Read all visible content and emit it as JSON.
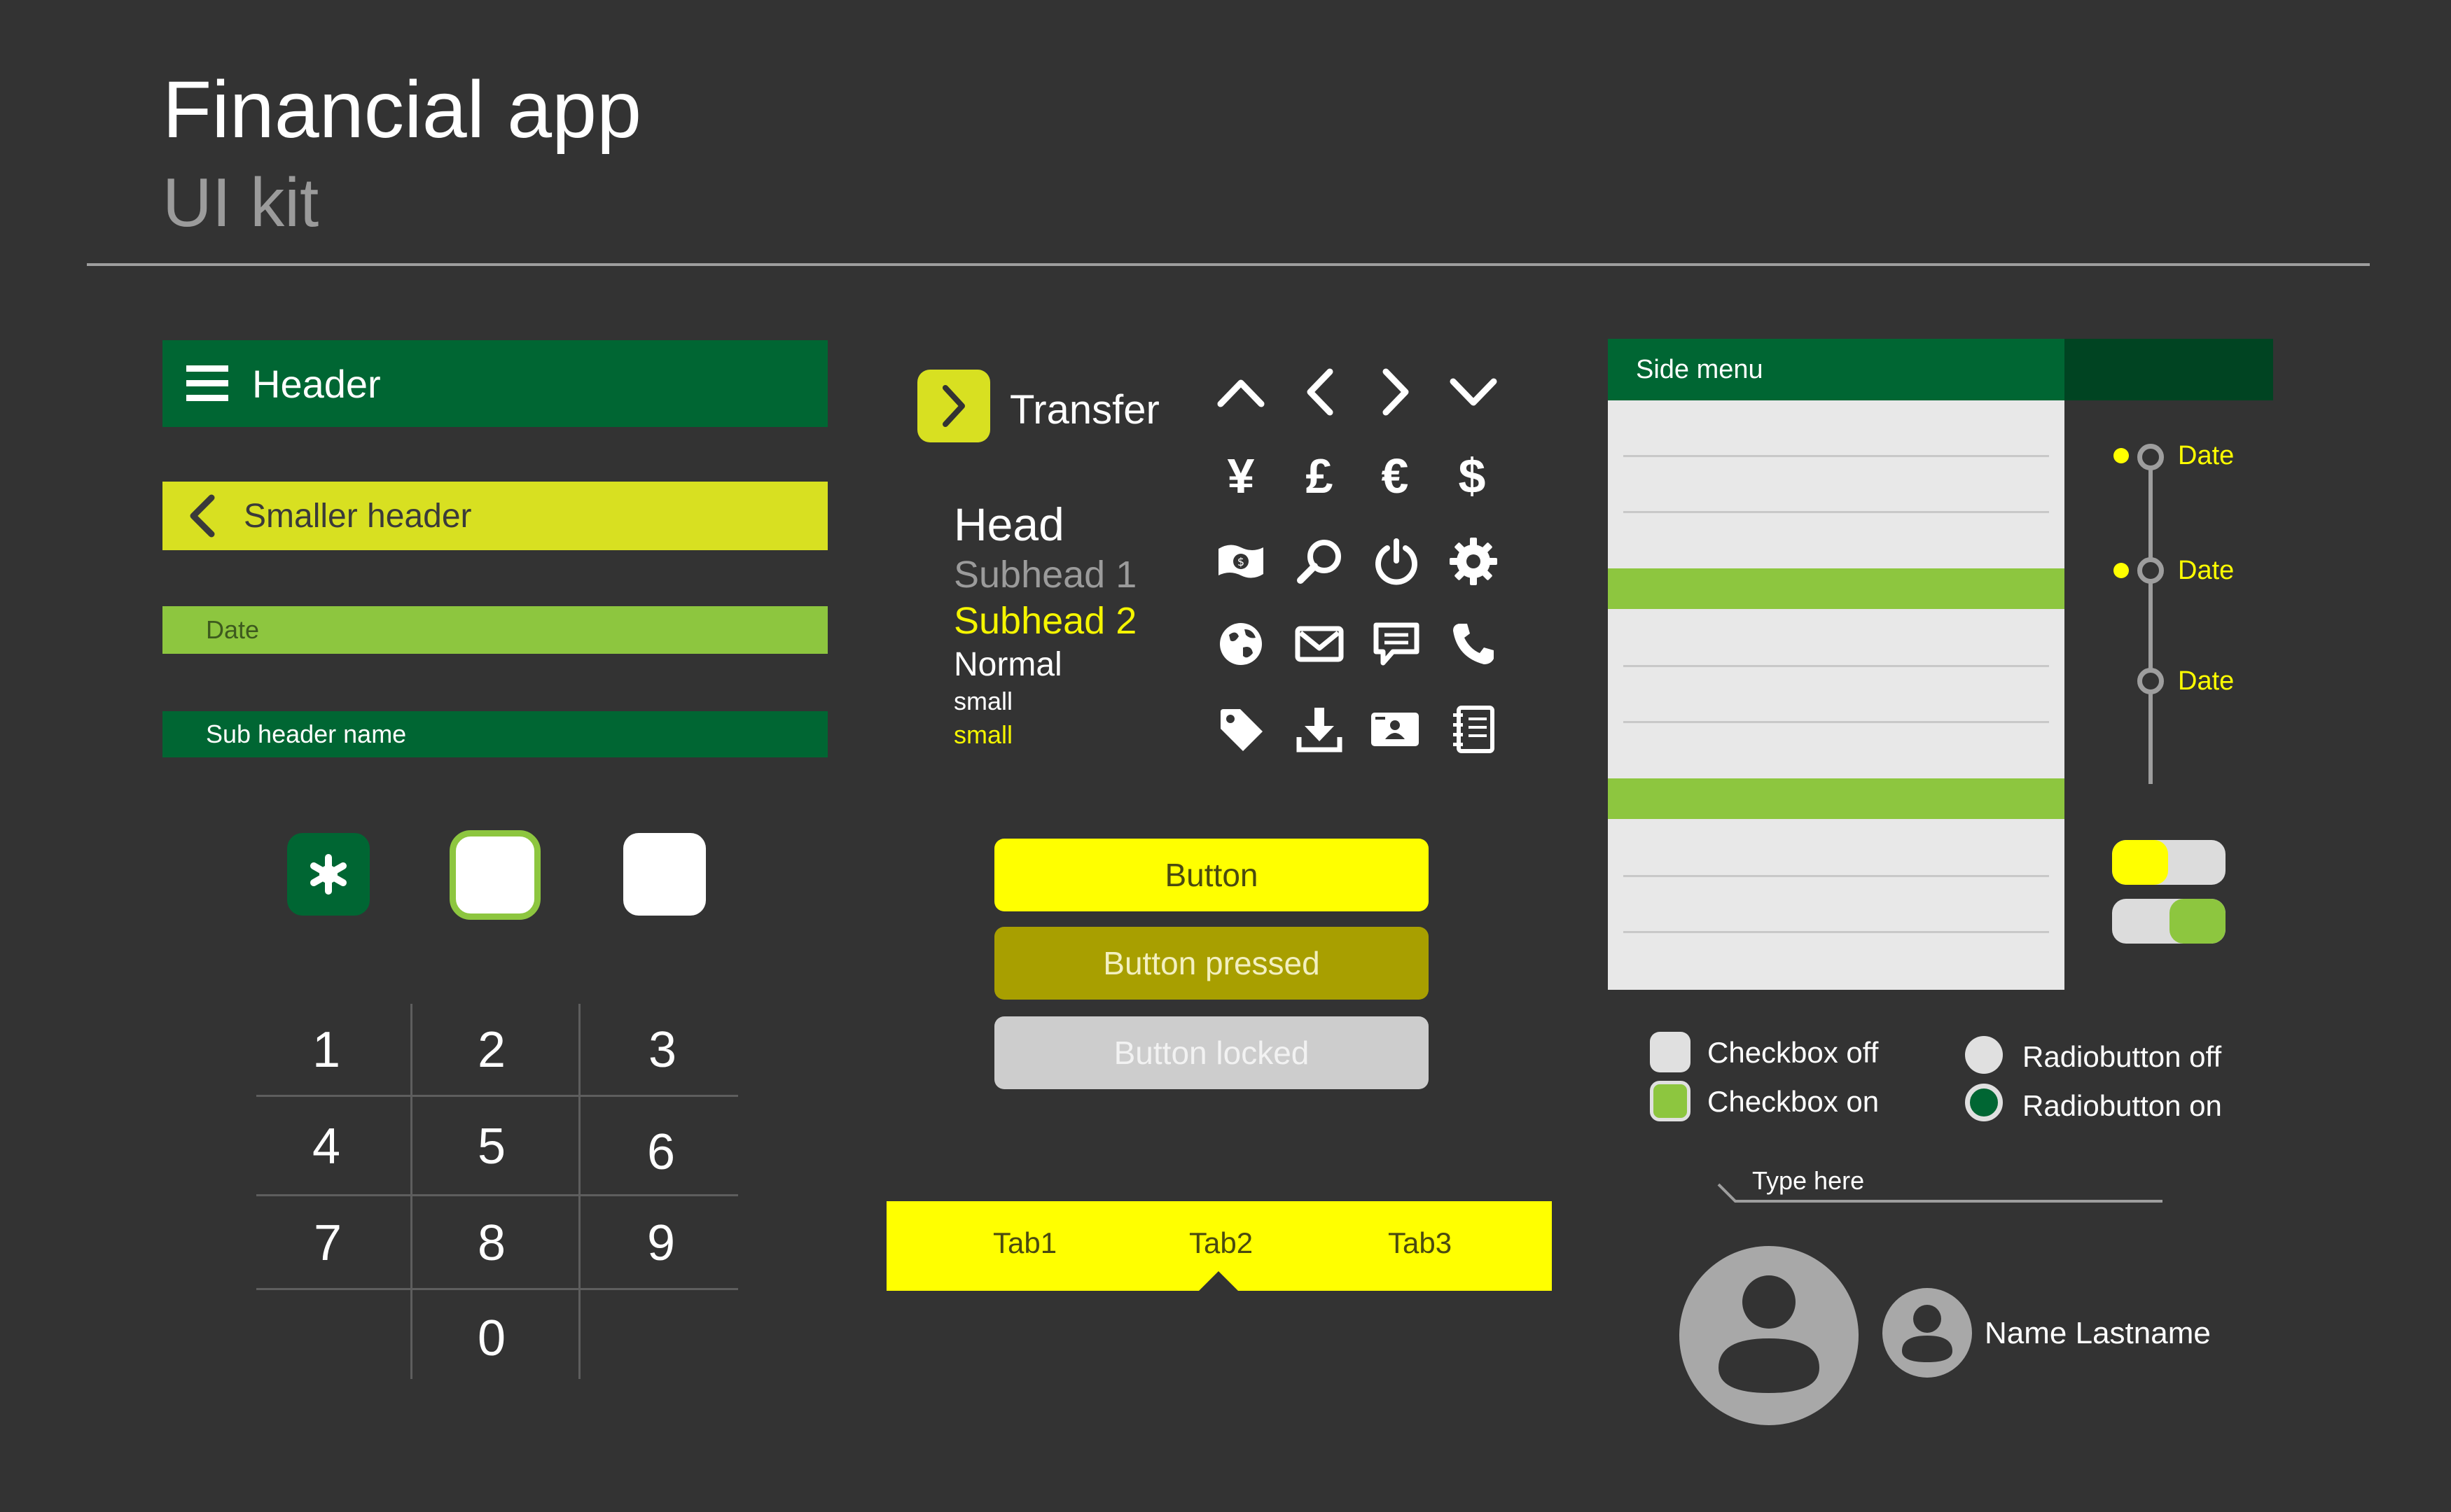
{
  "title": "Financial app",
  "subtitle": "UI kit",
  "headers": {
    "header": "Header",
    "smaller_header": "Smaller header",
    "date": "Date",
    "sub_header_name": "Sub header name"
  },
  "keypad": [
    "1",
    "2",
    "3",
    "4",
    "5",
    "6",
    "7",
    "8",
    "9",
    "0"
  ],
  "transfer": {
    "label": "Transfer"
  },
  "typography": {
    "head": "Head",
    "subhead1": "Subhead 1",
    "subhead2": "Subhead 2",
    "normal": "Normal",
    "small": "small",
    "small_accent": "small"
  },
  "currency": {
    "yen": "¥",
    "pound": "£",
    "euro": "€",
    "dollar": "$"
  },
  "icons": [
    "chevron-up-icon",
    "chevron-left-icon",
    "chevron-right-icon",
    "chevron-down-icon",
    "yen-icon",
    "pound-icon",
    "euro-icon",
    "dollar-icon",
    "money-icon",
    "search-icon",
    "power-icon",
    "gear-icon",
    "globe-icon",
    "mail-icon",
    "chat-icon",
    "phone-icon",
    "tag-icon",
    "download-icon",
    "id-card-icon",
    "notebook-icon"
  ],
  "buttons": {
    "normal": "Button",
    "pressed": "Button pressed",
    "locked": "Button locked"
  },
  "tabs": [
    "Tab1",
    "Tab2",
    "Tab3"
  ],
  "tabs_selected": 1,
  "side_menu": {
    "title": "Side menu"
  },
  "timeline": [
    "Date",
    "Date",
    "Date"
  ],
  "toggles": [
    {
      "state": "off"
    },
    {
      "state": "on"
    }
  ],
  "checkboxes": {
    "off": "Checkbox off",
    "on": "Checkbox on"
  },
  "radios": {
    "off": "Radiobutton off",
    "on": "Radiobutton on"
  },
  "input": {
    "placeholder": "Type here"
  },
  "profile": {
    "name": "Name Lastname"
  },
  "colors": {
    "background": "#333333",
    "dark_green": "#006633",
    "lime": "#8dc63f",
    "yellow": "#ffff00",
    "olive": "#a89f00",
    "yellow_green": "#d8e021",
    "grey": "#cdcdcd"
  }
}
